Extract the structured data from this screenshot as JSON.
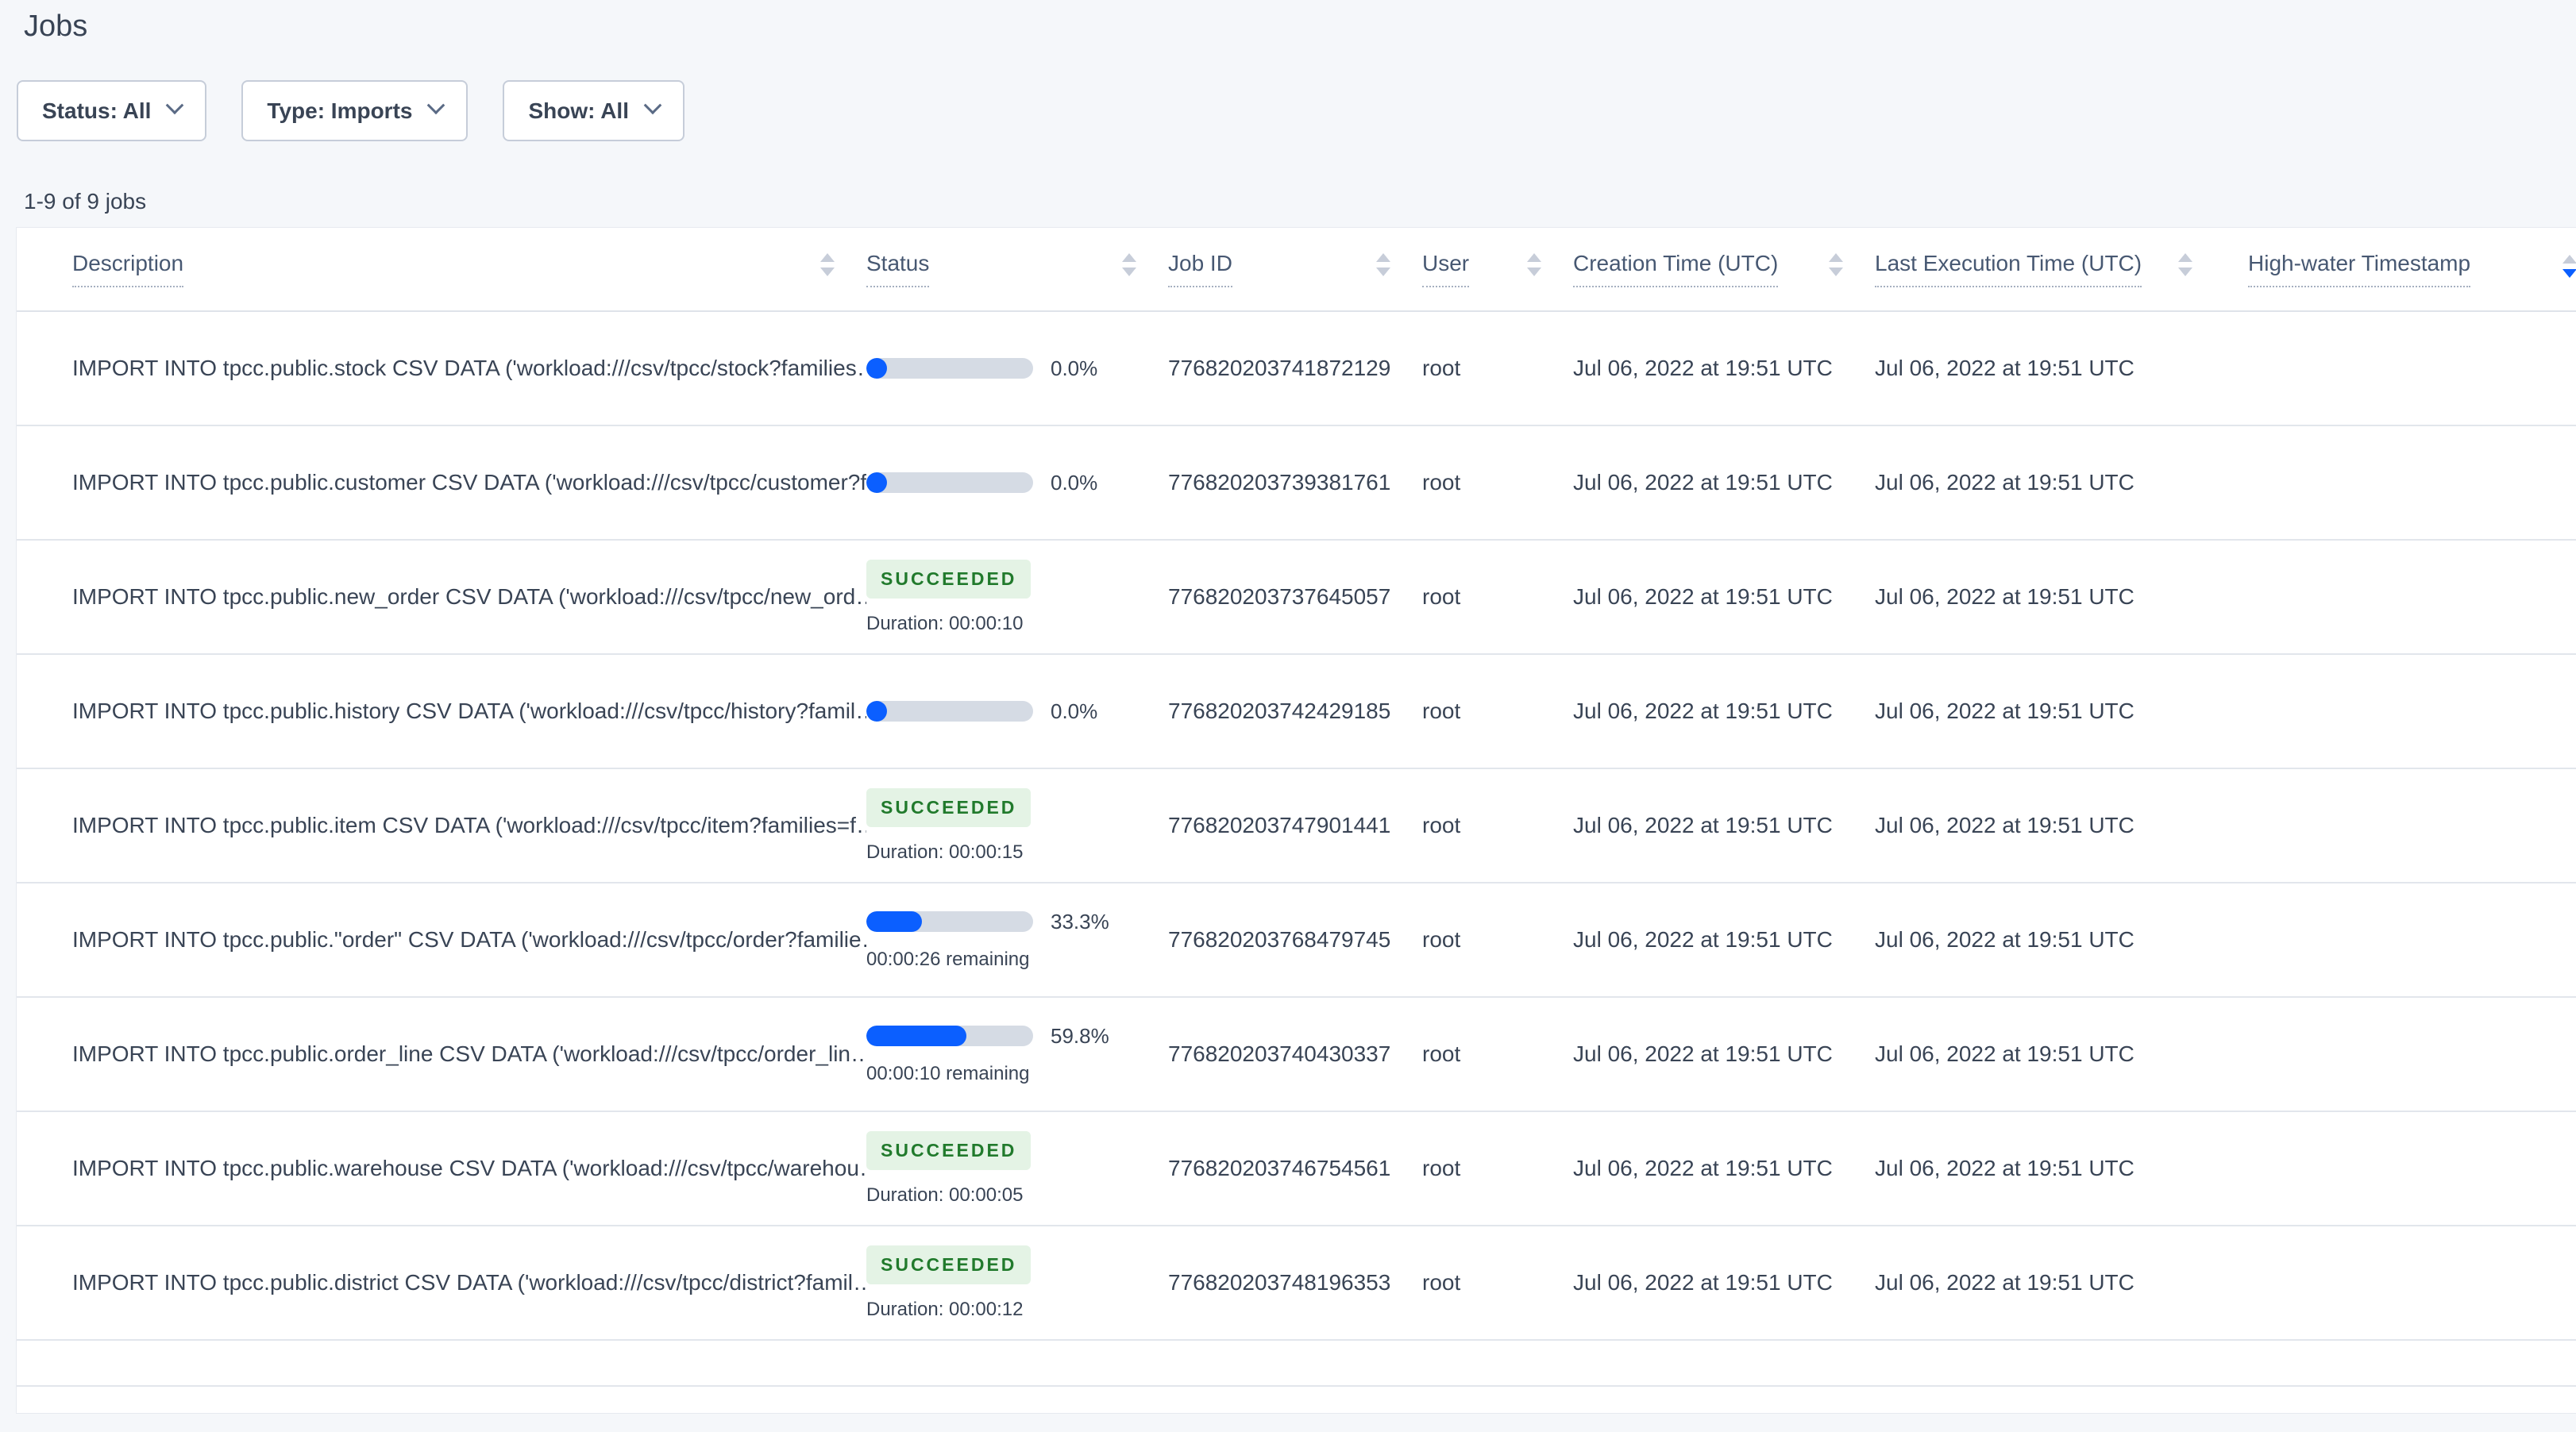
{
  "page": {
    "title": "Jobs",
    "count_label": "1-9 of 9 jobs"
  },
  "filters": [
    {
      "label": "Status: All"
    },
    {
      "label": "Type: Imports"
    },
    {
      "label": "Show: All"
    }
  ],
  "table": {
    "columns": [
      "Description",
      "Status",
      "Job ID",
      "User",
      "Creation Time (UTC)",
      "Last Execution Time (UTC)",
      "High-water Timestamp"
    ],
    "rows": [
      {
        "description": "IMPORT INTO tpcc.public.stock CSV DATA ('workload:///csv/tpcc/stock?families…",
        "status": {
          "kind": "progress",
          "percent": 0.0,
          "percent_label": "0.0%",
          "remaining": ""
        },
        "job_id": "776820203741872129",
        "user": "root",
        "creation_time": "Jul 06, 2022 at 19:51 UTC",
        "last_execution_time": "Jul 06, 2022 at 19:51 UTC",
        "high_water_timestamp": ""
      },
      {
        "description": "IMPORT INTO tpcc.public.customer CSV DATA ('workload:///csv/tpcc/customer?f…",
        "status": {
          "kind": "progress",
          "percent": 0.0,
          "percent_label": "0.0%",
          "remaining": ""
        },
        "job_id": "776820203739381761",
        "user": "root",
        "creation_time": "Jul 06, 2022 at 19:51 UTC",
        "last_execution_time": "Jul 06, 2022 at 19:51 UTC",
        "high_water_timestamp": ""
      },
      {
        "description": "IMPORT INTO tpcc.public.new_order CSV DATA ('workload:///csv/tpcc/new_ord…",
        "status": {
          "kind": "succeeded",
          "label": "SUCCEEDED",
          "duration": "Duration: 00:00:10"
        },
        "job_id": "776820203737645057",
        "user": "root",
        "creation_time": "Jul 06, 2022 at 19:51 UTC",
        "last_execution_time": "Jul 06, 2022 at 19:51 UTC",
        "high_water_timestamp": ""
      },
      {
        "description": "IMPORT INTO tpcc.public.history CSV DATA ('workload:///csv/tpcc/history?famil…",
        "status": {
          "kind": "progress",
          "percent": 0.0,
          "percent_label": "0.0%",
          "remaining": ""
        },
        "job_id": "776820203742429185",
        "user": "root",
        "creation_time": "Jul 06, 2022 at 19:51 UTC",
        "last_execution_time": "Jul 06, 2022 at 19:51 UTC",
        "high_water_timestamp": ""
      },
      {
        "description": "IMPORT INTO tpcc.public.item CSV DATA ('workload:///csv/tpcc/item?families=f…",
        "status": {
          "kind": "succeeded",
          "label": "SUCCEEDED",
          "duration": "Duration: 00:00:15"
        },
        "job_id": "776820203747901441",
        "user": "root",
        "creation_time": "Jul 06, 2022 at 19:51 UTC",
        "last_execution_time": "Jul 06, 2022 at 19:51 UTC",
        "high_water_timestamp": ""
      },
      {
        "description": "IMPORT INTO tpcc.public.\"order\" CSV DATA ('workload:///csv/tpcc/order?familie…",
        "status": {
          "kind": "progress",
          "percent": 33.3,
          "percent_label": "33.3%",
          "remaining": "00:00:26 remaining"
        },
        "job_id": "776820203768479745",
        "user": "root",
        "creation_time": "Jul 06, 2022 at 19:51 UTC",
        "last_execution_time": "Jul 06, 2022 at 19:51 UTC",
        "high_water_timestamp": ""
      },
      {
        "description": "IMPORT INTO tpcc.public.order_line CSV DATA ('workload:///csv/tpcc/order_lin…",
        "status": {
          "kind": "progress",
          "percent": 59.8,
          "percent_label": "59.8%",
          "remaining": "00:00:10 remaining"
        },
        "job_id": "776820203740430337",
        "user": "root",
        "creation_time": "Jul 06, 2022 at 19:51 UTC",
        "last_execution_time": "Jul 06, 2022 at 19:51 UTC",
        "high_water_timestamp": ""
      },
      {
        "description": "IMPORT INTO tpcc.public.warehouse CSV DATA ('workload:///csv/tpcc/warehou…",
        "status": {
          "kind": "succeeded",
          "label": "SUCCEEDED",
          "duration": "Duration: 00:00:05"
        },
        "job_id": "776820203746754561",
        "user": "root",
        "creation_time": "Jul 06, 2022 at 19:51 UTC",
        "last_execution_time": "Jul 06, 2022 at 19:51 UTC",
        "high_water_timestamp": ""
      },
      {
        "description": "IMPORT INTO tpcc.public.district CSV DATA ('workload:///csv/tpcc/district?famil…",
        "status": {
          "kind": "succeeded",
          "label": "SUCCEEDED",
          "duration": "Duration: 00:00:12"
        },
        "job_id": "776820203748196353",
        "user": "root",
        "creation_time": "Jul 06, 2022 at 19:51 UTC",
        "last_execution_time": "Jul 06, 2022 at 19:51 UTC",
        "high_water_timestamp": ""
      }
    ]
  },
  "colors": {
    "accent_blue": "#0b5fff",
    "progress_track": "#d5dbe4",
    "success_text": "#217a2c",
    "success_bg": "#e4f3e5",
    "page_bg": "#f5f7fa",
    "text_primary": "#394455",
    "text_secondary": "#475872"
  }
}
